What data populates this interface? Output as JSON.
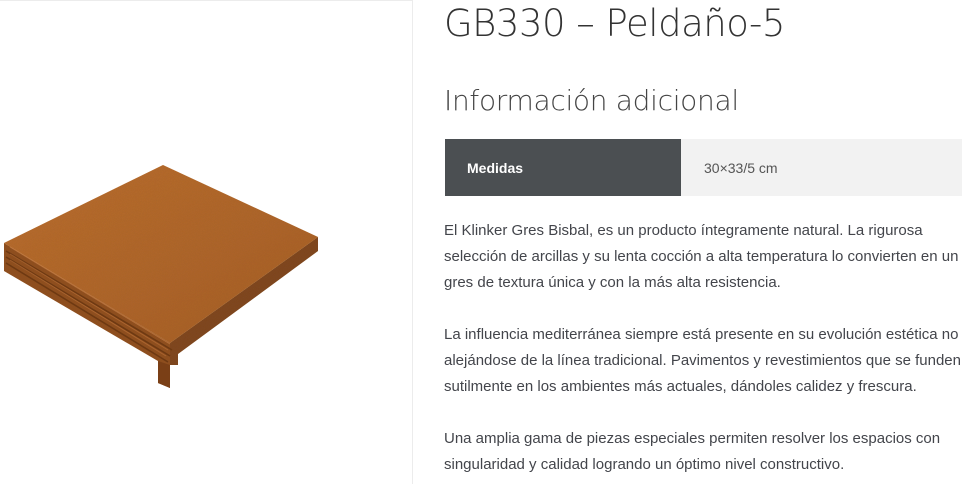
{
  "product": {
    "title": "GB330 – Peldaño-5"
  },
  "additional_info": {
    "heading": "Información adicional",
    "attributes": [
      {
        "label": "Medidas",
        "value": "30×33/5 cm"
      }
    ]
  },
  "description": {
    "paragraphs": [
      "El Klinker Gres Bisbal, es un producto íntegramente natural. La rigurosa selección de arcillas y su lenta cocción a alta temperatura lo convierten en un gres de textura única y con la más alta resistencia.",
      "La influencia mediterránea siempre está presente en su evolución estética no alejándose de la línea tradicional. Pavimentos y revestimientos que se funden sutilmente en los ambientes más actuales, dándoles calidez y frescura.",
      "Una amplia gama de piezas especiales permiten resolver los espacios con singularidad y calidad logrando un óptimo nivel constructivo."
    ]
  },
  "image": {
    "icon": "stair-tile-product-image",
    "colors": {
      "top": "#b8672a",
      "front": "#9c5420",
      "side": "#8a4a1c"
    }
  }
}
